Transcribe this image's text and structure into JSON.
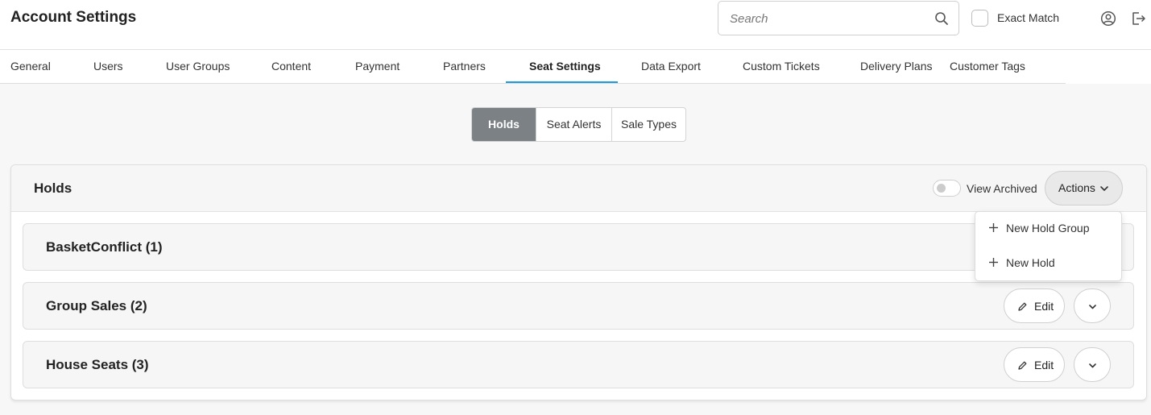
{
  "header": {
    "title": "Account Settings",
    "search_placeholder": "Search",
    "exact_match_label": "Exact Match",
    "icons": [
      "search-icon",
      "user-icon",
      "logout-icon"
    ]
  },
  "tabs": [
    {
      "label": "General"
    },
    {
      "label": "Users"
    },
    {
      "label": "User Groups"
    },
    {
      "label": "Content"
    },
    {
      "label": "Payment"
    },
    {
      "label": "Partners"
    },
    {
      "label": "Seat Settings",
      "active": true
    },
    {
      "label": "Data Export"
    },
    {
      "label": "Custom Tickets"
    },
    {
      "label": "Delivery Plans"
    },
    {
      "label": "Customer Tags"
    }
  ],
  "segments": [
    {
      "label": "Holds",
      "active": true
    },
    {
      "label": "Seat Alerts"
    },
    {
      "label": "Sale Types"
    }
  ],
  "card": {
    "title": "Holds",
    "view_archived_label": "View Archived",
    "view_archived_on": false,
    "actions_label": "Actions"
  },
  "rows": [
    {
      "title": "BasketConflict (1)"
    },
    {
      "title": "Group Sales (2)",
      "edit_label": "Edit"
    },
    {
      "title": "House Seats (3)",
      "edit_label": "Edit"
    }
  ],
  "dropdown": {
    "items": [
      {
        "label": "New Hold Group"
      },
      {
        "label": "New Hold"
      }
    ]
  },
  "colors": {
    "accent": "#1f9bdb",
    "segment_active": "#7b8185"
  }
}
